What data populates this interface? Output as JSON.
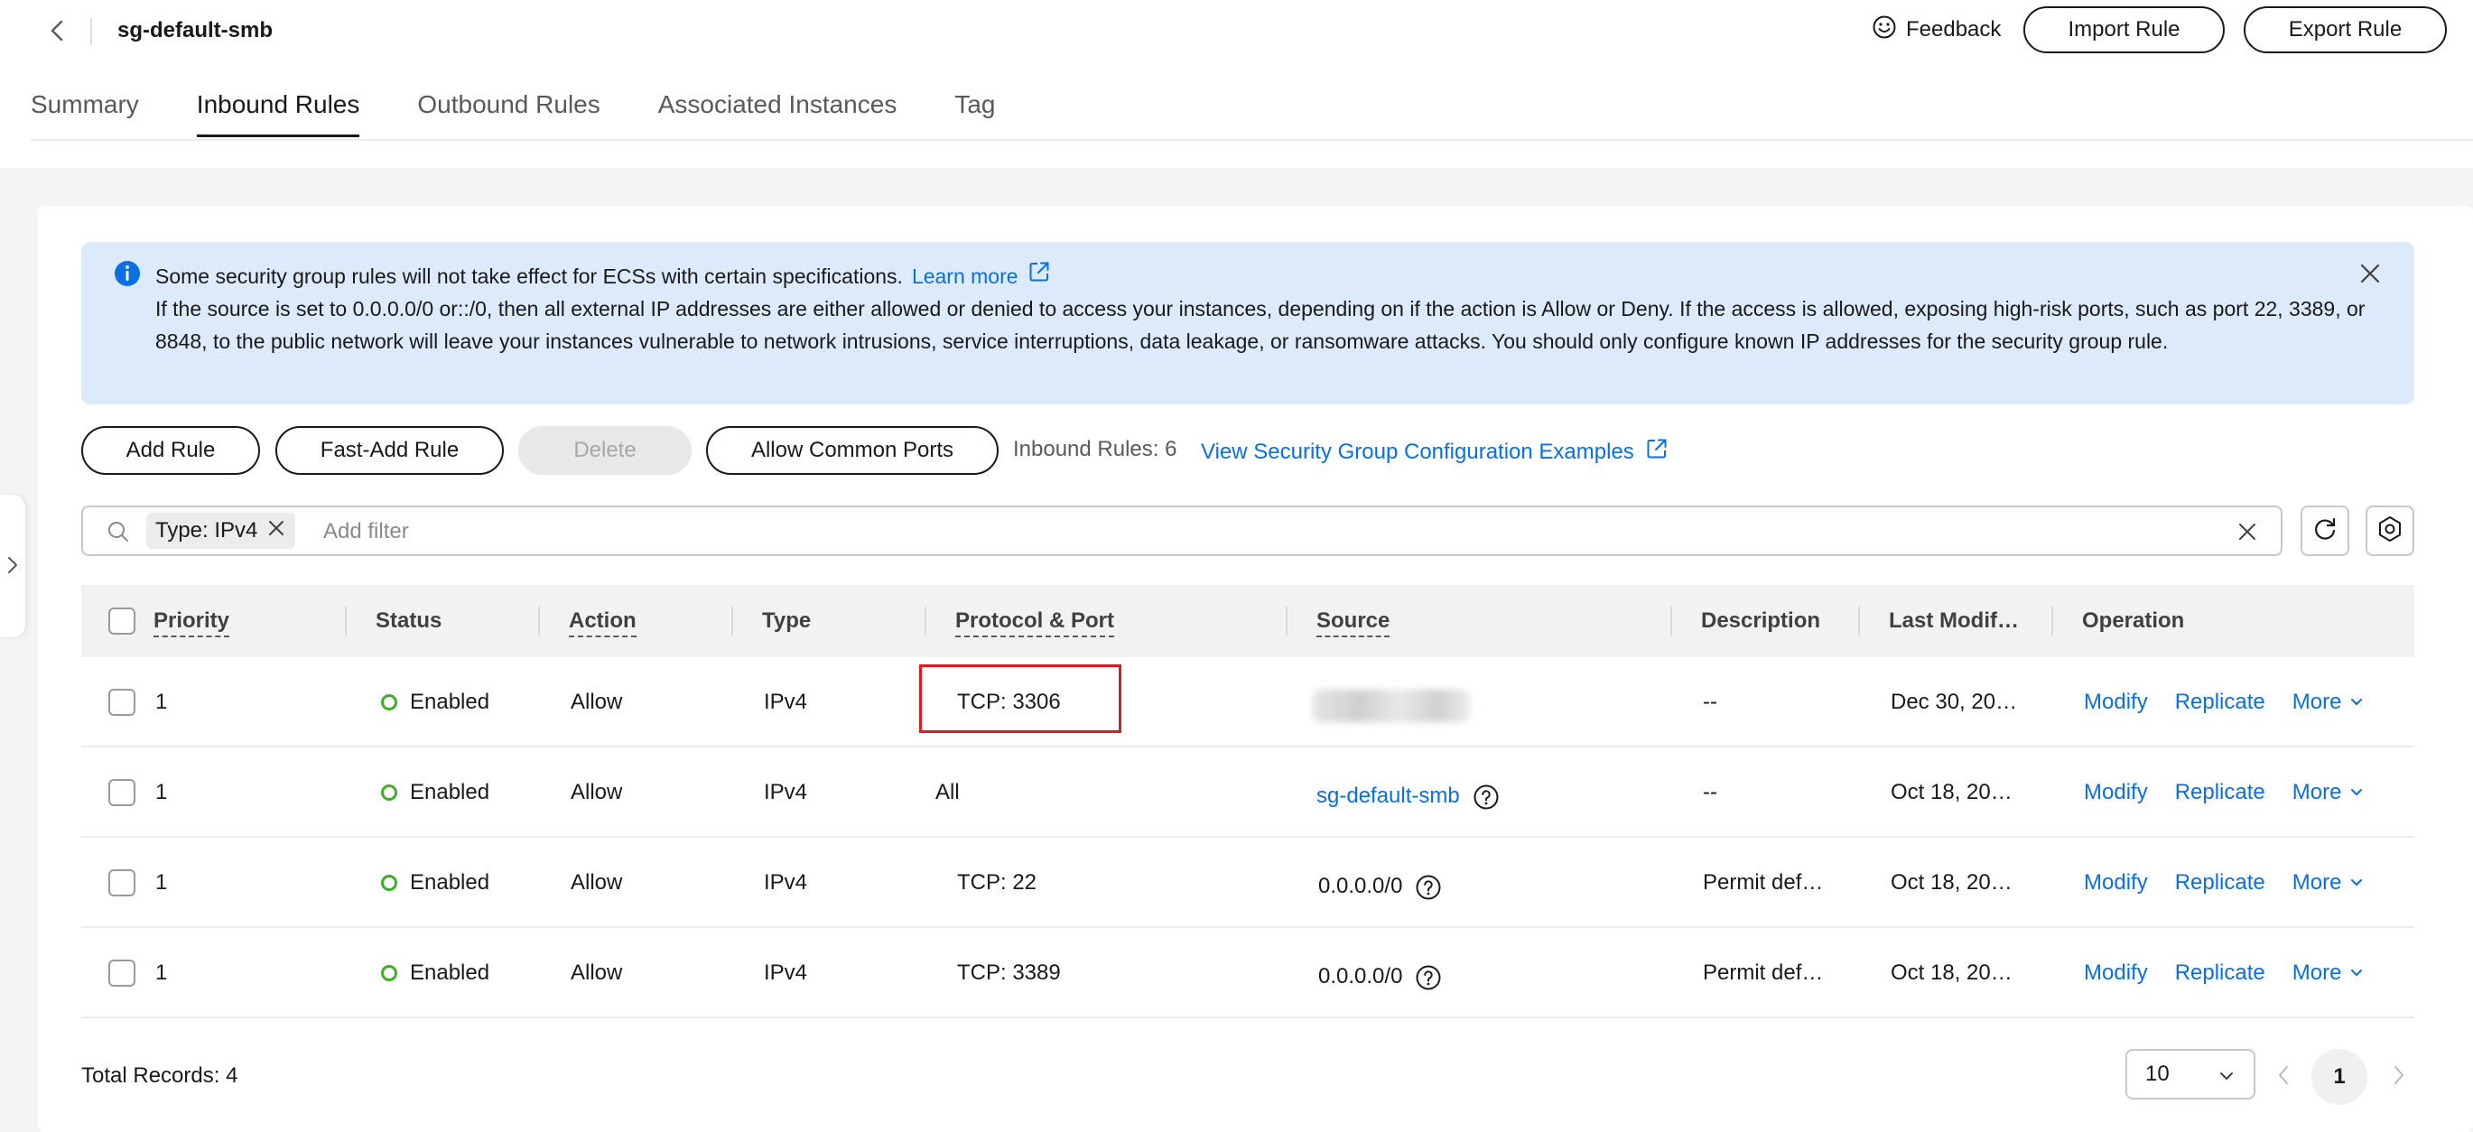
{
  "header": {
    "title": "sg-default-smb",
    "feedback_label": "Feedback",
    "import_label": "Import Rule",
    "export_label": "Export Rule"
  },
  "tabs": [
    {
      "label": "Summary"
    },
    {
      "label": "Inbound Rules",
      "active": true
    },
    {
      "label": "Outbound Rules"
    },
    {
      "label": "Associated Instances"
    },
    {
      "label": "Tag"
    }
  ],
  "alert": {
    "line1": "Some security group rules will not take effect for ECSs with certain specifications.",
    "learn_more": "Learn more",
    "body": "If the source is set to 0.0.0.0/0 or::/0, then all external IP addresses are either allowed or denied to access your instances, depending on if the action is Allow or Deny. If the access is allowed, exposing high-risk ports, such as port 22, 3389, or 8848, to the public network will leave your instances vulnerable to network intrusions, service interruptions, data leakage, or ransomware attacks. You should only configure known IP addresses for the security group rule."
  },
  "toolbar": {
    "add_rule": "Add Rule",
    "fast_add_rule": "Fast-Add Rule",
    "delete": "Delete",
    "allow_common_ports": "Allow Common Ports",
    "inbound_count": "Inbound Rules: 6",
    "examples_link": "View Security Group Configuration Examples"
  },
  "search": {
    "chip": "Type: IPv4",
    "placeholder": "Add filter"
  },
  "table": {
    "columns": {
      "priority": "Priority",
      "status": "Status",
      "action": "Action",
      "type": "Type",
      "protocol_port": "Protocol & Port",
      "source": "Source",
      "description": "Description",
      "last_modified": "Last Modif…",
      "operation": "Operation"
    },
    "rows": [
      {
        "priority": "1",
        "status": "Enabled",
        "action": "Allow",
        "type": "IPv4",
        "protocol_port": "TCP: 3306",
        "source": "",
        "description": "--",
        "last_modified": "Dec 30, 20…",
        "modify": "Modify",
        "replicate": "Replicate",
        "more": "More"
      },
      {
        "priority": "1",
        "status": "Enabled",
        "action": "Allow",
        "type": "IPv4",
        "protocol_port": "All",
        "source": "sg-default-smb",
        "description": "--",
        "last_modified": "Oct 18, 20…",
        "modify": "Modify",
        "replicate": "Replicate",
        "more": "More"
      },
      {
        "priority": "1",
        "status": "Enabled",
        "action": "Allow",
        "type": "IPv4",
        "protocol_port": "TCP: 22",
        "source": "0.0.0.0/0",
        "description": "Permit def…",
        "last_modified": "Oct 18, 20…",
        "modify": "Modify",
        "replicate": "Replicate",
        "more": "More"
      },
      {
        "priority": "1",
        "status": "Enabled",
        "action": "Allow",
        "type": "IPv4",
        "protocol_port": "TCP: 3389",
        "source": "0.0.0.0/0",
        "description": "Permit def…",
        "last_modified": "Oct 18, 20…",
        "modify": "Modify",
        "replicate": "Replicate",
        "more": "More"
      }
    ]
  },
  "footer": {
    "total": "Total Records: 4",
    "page_size": "10",
    "current_page": "1"
  },
  "colors": {
    "link": "#0a6fe1",
    "status_enabled": "#3fae29",
    "alert_bg": "#dceafb",
    "highlight": "#e0191e"
  }
}
